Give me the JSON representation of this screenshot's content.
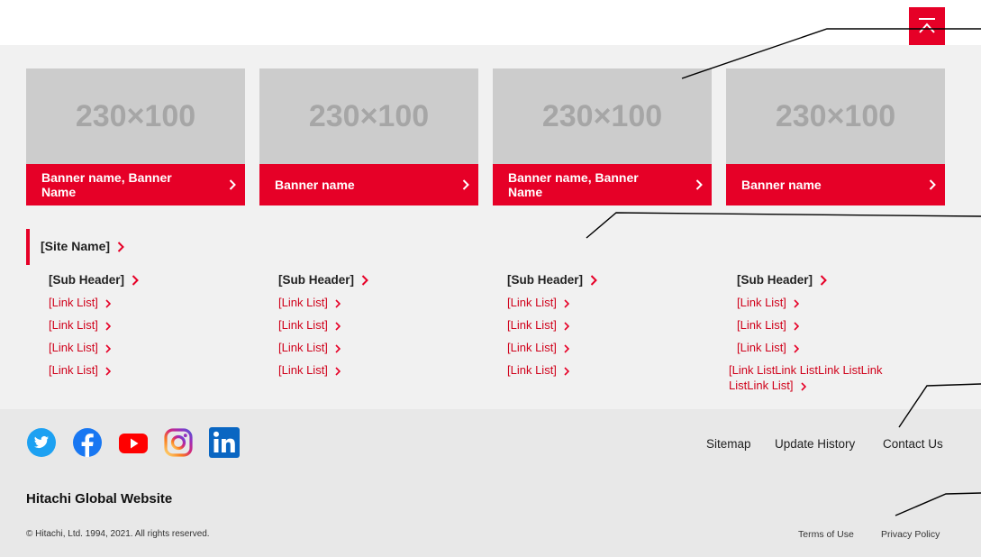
{
  "banners": [
    {
      "image_label": "230×100",
      "name": "Banner name, Banner Name"
    },
    {
      "image_label": "230×100",
      "name": "Banner name"
    },
    {
      "image_label": "230×100",
      "name": "Banner name, Banner Name"
    },
    {
      "image_label": "230×100",
      "name": "Banner name"
    }
  ],
  "site": {
    "name": "[Site Name]",
    "columns": [
      {
        "sub_header": "[Sub Header]",
        "links": [
          "[Link List]",
          "[Link List]",
          "[Link List]",
          "[Link List]"
        ]
      },
      {
        "sub_header": "[Sub Header]",
        "links": [
          "[Link List]",
          "[Link List]",
          "[Link List]",
          "[Link List]"
        ]
      },
      {
        "sub_header": "[Sub Header]",
        "links": [
          "[Link List]",
          "[Link List]",
          "[Link List]",
          "[Link List]"
        ]
      },
      {
        "sub_header": "[Sub Header]",
        "links": [
          "[Link List]",
          "[Link List]",
          "[Link List]",
          "[Link ListLink ListLink ListLink ListLink List]"
        ]
      }
    ]
  },
  "footer": {
    "social_icons": [
      "twitter-icon",
      "facebook-icon",
      "youtube-icon",
      "instagram-icon",
      "linkedin-icon"
    ],
    "nav": {
      "sitemap": "Sitemap",
      "update_history": "Update History",
      "contact_us": "Contact Us"
    },
    "brand": "Hitachi Global Website",
    "copyright": "© Hitachi, Ltd. 1994, 2021. All rights reserved.",
    "legal": {
      "terms": "Terms of Use",
      "privacy": "Privacy Policy"
    }
  },
  "colors": {
    "accent": "#e60027",
    "link": "#d0021b",
    "band_bg": "#f1f1f1",
    "footer_bg": "#e8e8e8",
    "placeholder_bg": "#cccccc",
    "twitter": "#1da1f2",
    "facebook": "#1877f2",
    "youtube": "#ff0000",
    "linkedin": "#0a66c2"
  }
}
